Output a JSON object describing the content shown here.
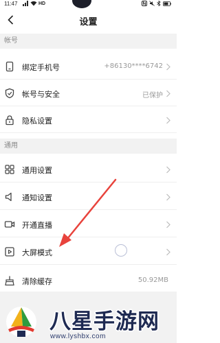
{
  "status_bar": {
    "time": "11:47",
    "network": "HD"
  },
  "nav": {
    "title": "设置"
  },
  "sections": [
    {
      "header": "帐号",
      "rows": [
        {
          "label": "绑定手机号",
          "value": "+86130****6742",
          "icon": "phone-icon"
        },
        {
          "label": "帐号与安全",
          "value": "已保护",
          "icon": "shield-icon"
        },
        {
          "label": "隐私设置",
          "value": "",
          "icon": "lock-icon"
        }
      ]
    },
    {
      "header": "通用",
      "rows": [
        {
          "label": "通用设置",
          "value": "",
          "icon": "grid-icon"
        },
        {
          "label": "通知设置",
          "value": "",
          "icon": "speaker-icon"
        },
        {
          "label": "开通直播",
          "value": "",
          "icon": "video-camera-icon"
        },
        {
          "label": "大屏模式",
          "value": "",
          "icon": "play-screen-icon"
        },
        {
          "label": "清除缓存",
          "value": "50.92MB",
          "icon": "broom-icon"
        }
      ]
    }
  ],
  "watermark": {
    "title": "八星手游网",
    "url": "www.lyshbx.com"
  },
  "colors": {
    "arrow": "#e8433c",
    "accent_blue": "#1e2a52"
  }
}
